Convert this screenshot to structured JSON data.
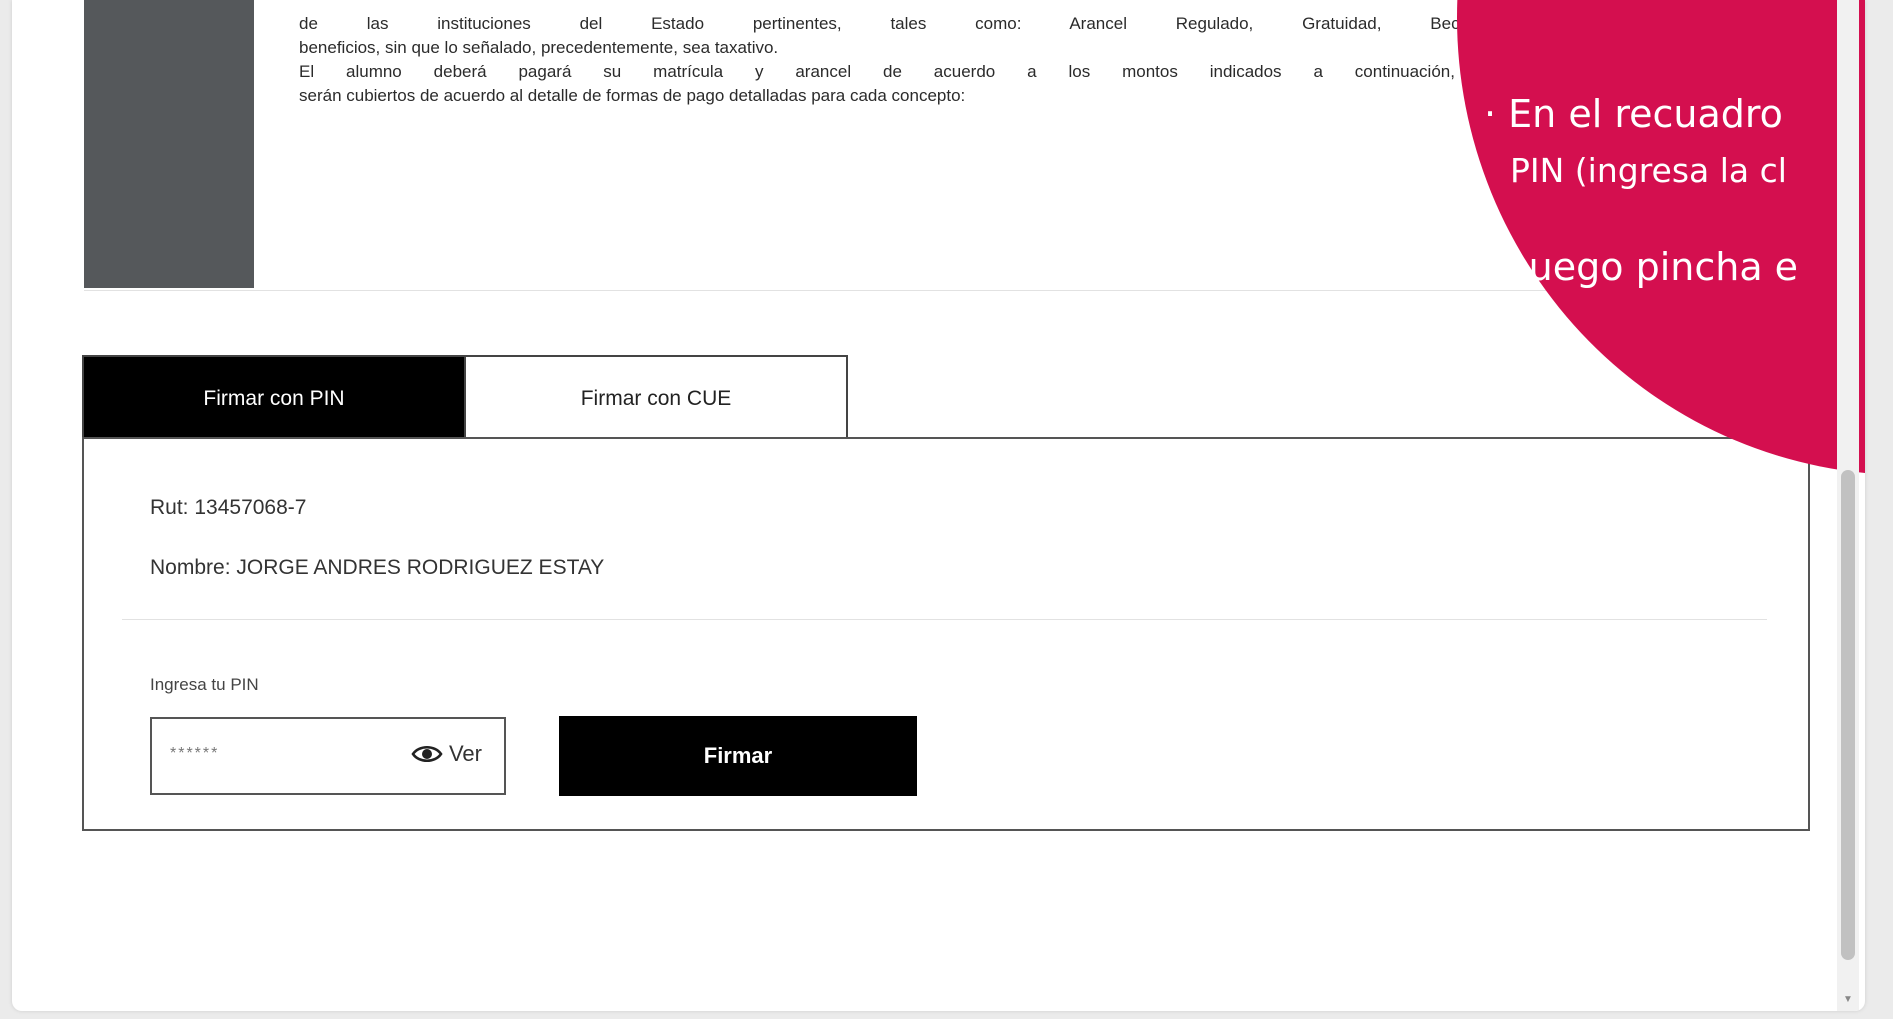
{
  "document": {
    "lines": [
      "de las instituciones del Estado pertinentes, tales como: Arancel Regulado, Gratuidad, Becas y/u",
      "beneficios, sin que lo señalado, precedentemente, sea taxativo.",
      "El alumno deberá pagará su matrícula y arancel de acuerdo a los montos indicados a continuación, los c",
      "serán cubiertos de acuerdo al detalle de formas de pago detalladas para cada concepto:"
    ]
  },
  "tabs": {
    "pin_label": "Firmar con PIN",
    "cue_label": "Firmar con CUE"
  },
  "user": {
    "rut": "Rut: 13457068-7",
    "nombre": "Nombre: JORGE ANDRES RODRIGUEZ ESTAY"
  },
  "pin": {
    "label": "Ingresa tu PIN",
    "masked_value": "******",
    "show_label": "Ver"
  },
  "sign_button": "Firmar",
  "callout": {
    "line1": "· En el recuadro",
    "line2": "PIN (ingresa la cl",
    "line3": "· Luego pincha e",
    "color": "#d40f4f"
  },
  "icons": {
    "show_password": "eye-icon"
  }
}
